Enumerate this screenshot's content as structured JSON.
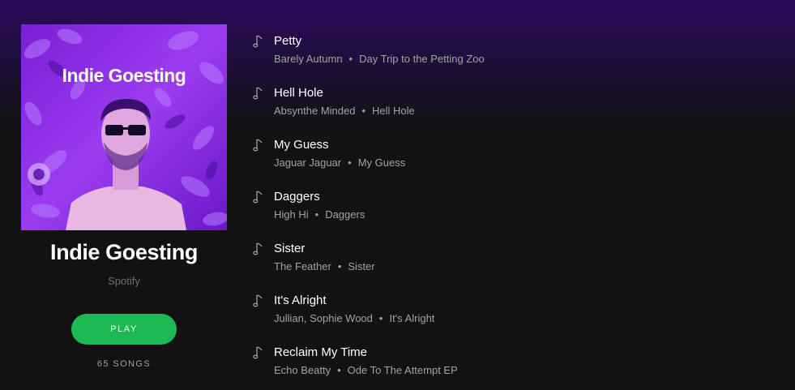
{
  "cover": {
    "title": "Indie Goesting"
  },
  "playlist": {
    "title": "Indie Goesting",
    "owner": "Spotify",
    "play_label": "PLAY",
    "song_count": "65 SONGS"
  },
  "colors": {
    "accent": "#1db954",
    "cover_purple": "#8a2be2",
    "header_gradient": "#2a0a5e",
    "background": "#121212"
  },
  "tracks": [
    {
      "name": "Petty",
      "artist": "Barely Autumn",
      "album": "Day Trip to the Petting Zoo",
      "icon": "music-note-icon"
    },
    {
      "name": "Hell Hole",
      "artist": "Absynthe Minded",
      "album": "Hell Hole",
      "icon": "music-note-icon"
    },
    {
      "name": "My Guess",
      "artist": "Jaguar Jaguar",
      "album": "My Guess",
      "icon": "music-note-icon"
    },
    {
      "name": "Daggers",
      "artist": "High Hi",
      "album": "Daggers",
      "icon": "music-note-icon"
    },
    {
      "name": "Sister",
      "artist": "The Feather",
      "album": "Sister",
      "icon": "music-note-icon"
    },
    {
      "name": "It's Alright",
      "artist": "Jullian, Sophie Wood",
      "album": "It's Alright",
      "icon": "music-note-icon"
    },
    {
      "name": "Reclaim My Time",
      "artist": "Echo Beatty",
      "album": "Ode To The Attempt EP",
      "icon": "music-note-icon"
    }
  ]
}
